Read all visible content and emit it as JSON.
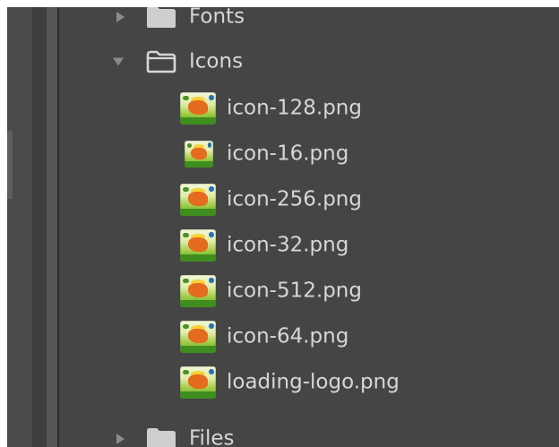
{
  "tree": {
    "folders_top": [
      {
        "label": "Fonts",
        "state": "collapsed",
        "icon": "folder-filled-icon"
      },
      {
        "label": "Icons",
        "state": "expanded",
        "icon": "folder-outline-icon"
      }
    ],
    "files": [
      {
        "label": "icon-128.png",
        "icon": "image-thumbnail-icon"
      },
      {
        "label": "icon-16.png",
        "icon": "image-thumbnail-icon"
      },
      {
        "label": "icon-256.png",
        "icon": "image-thumbnail-icon"
      },
      {
        "label": "icon-32.png",
        "icon": "image-thumbnail-icon"
      },
      {
        "label": "icon-512.png",
        "icon": "image-thumbnail-icon"
      },
      {
        "label": "icon-64.png",
        "icon": "image-thumbnail-icon"
      },
      {
        "label": "loading-logo.png",
        "icon": "image-thumbnail-icon"
      }
    ],
    "folders_bottom": [
      {
        "label": "Files",
        "state": "collapsed",
        "icon": "folder-filled-icon"
      }
    ]
  },
  "colors": {
    "panel_background": "#454545",
    "text": "#d6d6d6",
    "arrow": "#8a8a8a",
    "folder_icon": "#cfcfcf"
  }
}
